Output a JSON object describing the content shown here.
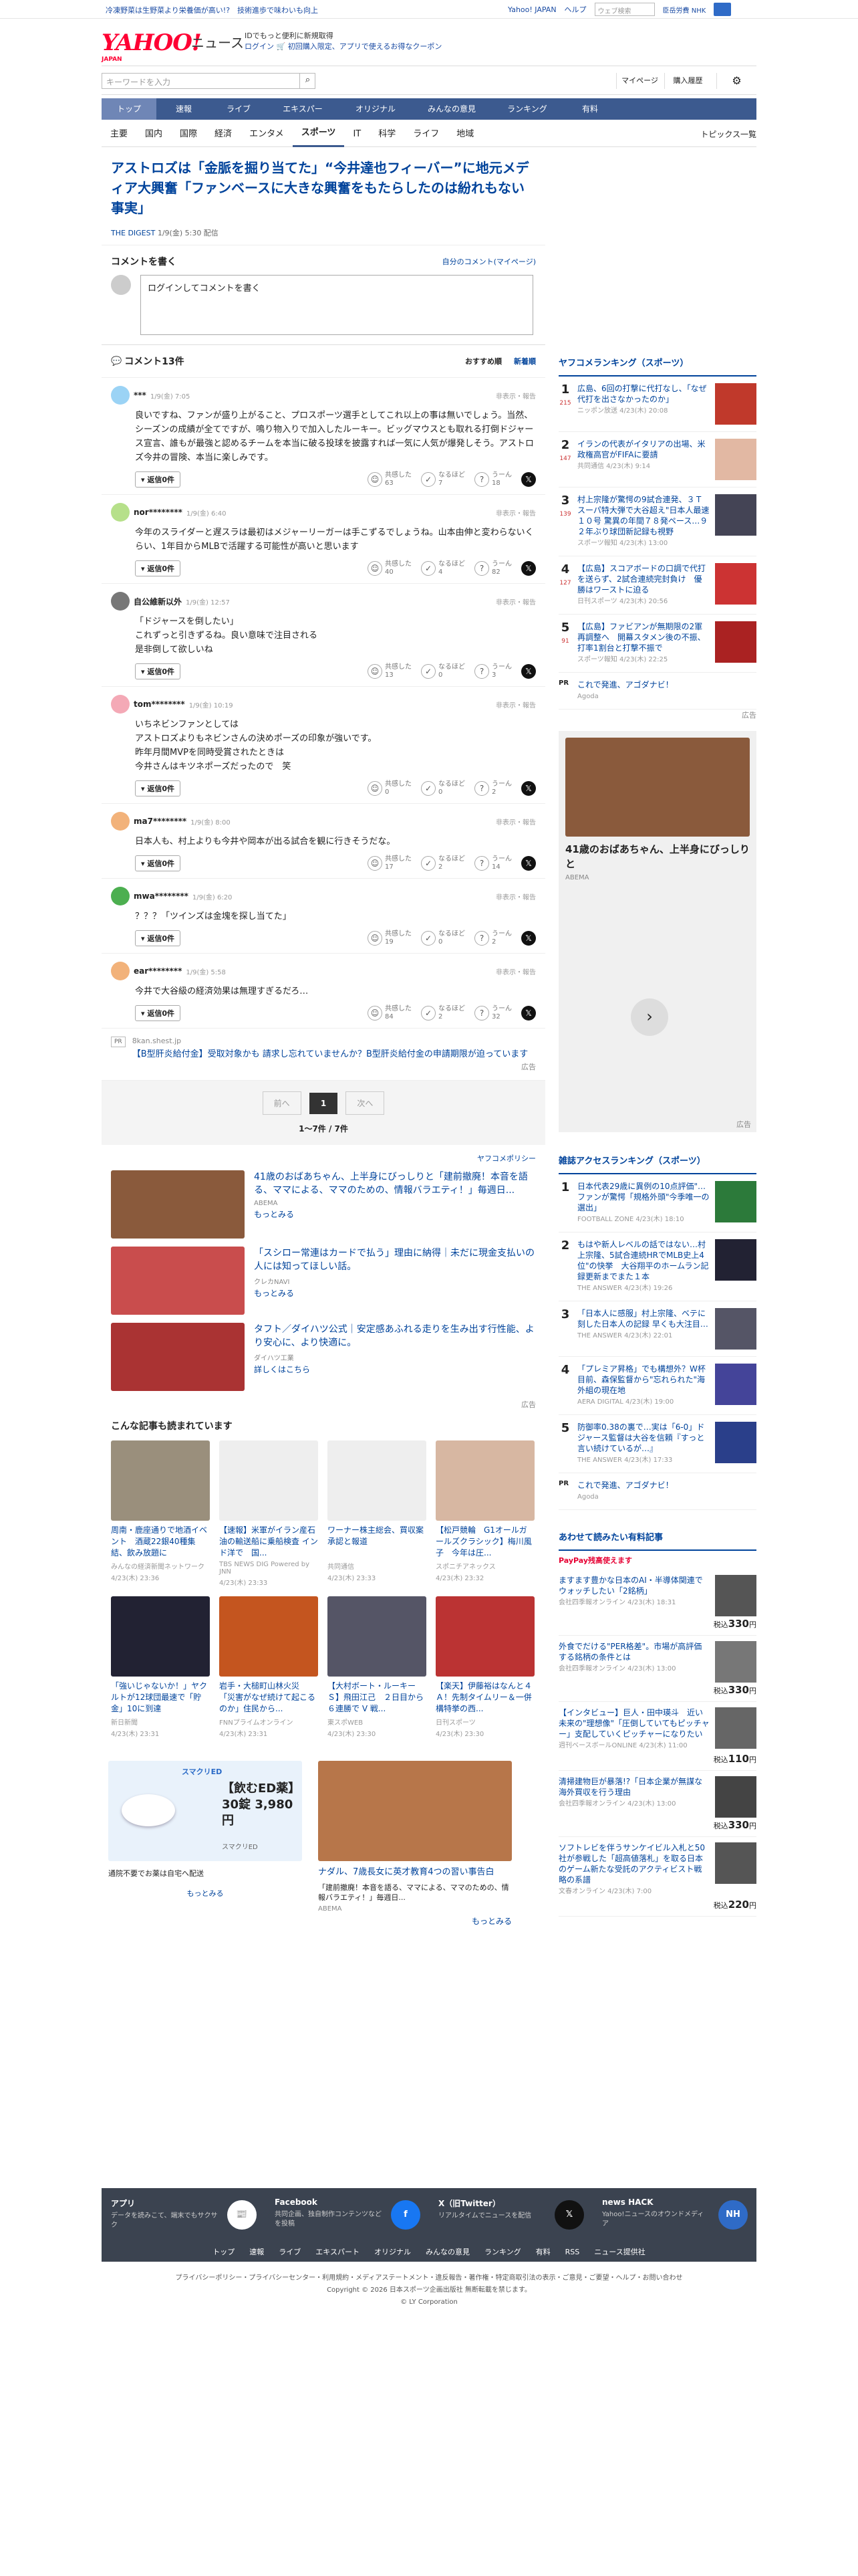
{
  "topbar": {
    "promo": "冷凍野菜は生野菜より栄養価が高い!?　技術進歩で味わいも向上",
    "links": [
      "Yahoo! JAPAN",
      "ヘルプ"
    ],
    "search_placeholder": "ウェブ検索",
    "tag": "臣岳労費 NHK"
  },
  "header": {
    "logo": "YAHOO!",
    "logo_sub": "JAPAN",
    "logo_news": "ニュース",
    "promo_line1": "IDでもっと便利に新規取得",
    "promo_line2": "ログイン 🛒 初回購入限定、アプリで使えるお得なクーポン"
  },
  "search": {
    "placeholder": "キーワードを入力",
    "mypage": "マイページ",
    "subscribe": "購入履歴"
  },
  "gnav": [
    "トップ",
    "速報",
    "ライブ",
    "エキスパート",
    "オリジナル",
    "みんなの意見",
    "ランキング",
    "有料"
  ],
  "subnav": {
    "items": [
      "主要",
      "国内",
      "国際",
      "経済",
      "エンタメ",
      "スポーツ",
      "IT",
      "科学",
      "ライフ",
      "地域"
    ],
    "active": 5,
    "topics": "トピックス一覧"
  },
  "article": {
    "title": "アストロズは「金脈を掘り当てた」“今井達也フィーバー”に地元メディア大興奮「ファンベースに大きな興奮をもたらしたのは紛れもない事実」",
    "source": "THE DIGEST",
    "date": "1/9(金) 5:30 配信"
  },
  "comment_write": {
    "title": "コメントを書く",
    "mine": "自分のコメント(マイページ)",
    "placeholder": "ログインしてコメントを書く"
  },
  "comments_head": {
    "count": "コメント13件",
    "sort1": "おすすめ順",
    "sort2": "新着順"
  },
  "comments": [
    {
      "user": "***",
      "date": "1/9(金) 7:05",
      "report": "非表示・報告",
      "body": "良いですね、ファンが盛り上がること、プロスポーツ選手としてこれ以上の事は無いでしょう。当然、シーズンの成績が全てですが、鳴り物入りで加入したルーキー。ビッグマウスとも取れる打倒ドジャース宣言、誰もが最強と認めるチームを本当に破る投球を披露すれば一気に人気が爆発しそう。アストロズ今井の冒険、本当に楽しみです。",
      "reply": "返信0件",
      "k1": "共感した",
      "v1": "63",
      "k2": "なるほど",
      "v2": "7",
      "k3": "うーん",
      "v3": "18",
      "color": "#9bd3f5"
    },
    {
      "user": "nor********",
      "date": "1/9(金) 6:40",
      "report": "非表示・報告",
      "body": "今年のスライダーと遅スラは最初はメジャーリーガーは手こずるでしょうね。山本由伸と変わらないくらい、1年目からMLBで活躍する可能性が高いと思います",
      "reply": "返信0件",
      "k1": "共感した",
      "v1": "40",
      "k2": "なるほど",
      "v2": "4",
      "k3": "うーん",
      "v3": "82",
      "color": "#b6e08a"
    },
    {
      "user": "自公維新以外",
      "date": "1/9(金) 12:57",
      "report": "非表示・報告",
      "body": "「ドジャースを倒したい」\nこれずっと引きずるね。良い意味で注目される\n是非倒して欲しいね",
      "reply": "返信0件",
      "k1": "共感した",
      "v1": "13",
      "k2": "なるほど",
      "v2": "0",
      "k3": "うーん",
      "v3": "3",
      "color": "#777"
    },
    {
      "user": "tom********",
      "date": "1/9(金) 10:19",
      "report": "非表示・報告",
      "body": "いちネビンファンとしては\nアストロズよりもネビンさんの決めポーズの印象が強いです。\n昨年月間MVPを同時受賞されたときは\n今井さんはキツネポーズだったので　笑",
      "reply": "返信0件",
      "k1": "共感した",
      "v1": "0",
      "k2": "なるほど",
      "v2": "0",
      "k3": "うーん",
      "v3": "2",
      "color": "#f4a9b6"
    },
    {
      "user": "ma7********",
      "date": "1/9(金) 8:00",
      "report": "非表示・報告",
      "body": "日本人も、村上よりも今井や岡本が出る試合を観に行きそうだな。",
      "reply": "返信0件",
      "k1": "共感した",
      "v1": "17",
      "k2": "なるほど",
      "v2": "2",
      "k3": "うーん",
      "v3": "14",
      "color": "#f2b27a"
    },
    {
      "user": "mwa********",
      "date": "1/9(金) 6:20",
      "report": "非表示・報告",
      "body": "？？？「ツインズは金塊を探し当てた」",
      "reply": "返信0件",
      "k1": "共感した",
      "v1": "19",
      "k2": "なるほど",
      "v2": "0",
      "k3": "うーん",
      "v3": "2",
      "color": "#4caf50"
    },
    {
      "user": "ear********",
      "date": "1/9(金) 5:58",
      "report": "非表示・報告",
      "body": "今井で大谷級の経済効果は無理すぎるだろ…",
      "reply": "返信0件",
      "k1": "共感した",
      "v1": "84",
      "k2": "なるほど",
      "v2": "2",
      "k3": "うーん",
      "v3": "32",
      "color": "#f2b27a"
    }
  ],
  "pr": {
    "tag": "PR",
    "source": "8kan.shest.jp",
    "title": "【B型肝炎給付金】受取対象かも 請求し忘れていませんか？B型肝炎給付金の申請期限が迫っています",
    "ad": "広告"
  },
  "pager": {
    "prev": "前へ",
    "cur": "1",
    "next": "次へ",
    "info": "1〜7件 / 7件"
  },
  "ads": {
    "policy": "ヤフコメポリシー",
    "items": [
      {
        "title": "41歳のおばあちゃん、上半身にびっしりと「建前撤廃！本音を語る、ママによる、ママのための、情報バラエティ！」毎週日...",
        "src": "ABEMA",
        "link": "もっとみる",
        "color": "#8a5a3c"
      },
      {
        "title": "「スシロー常連はカードで払う」理由に納得｜未だに現金支払いの人には知ってほしい話。",
        "src": "クレカNAVI",
        "link": "もっとみる",
        "color": "#c94d4d"
      },
      {
        "title": "タフト／ダイハツ公式｜安定感あふれる走りを生み出す行性能、より安心に、より快適に。",
        "src": "ダイハツ工業",
        "link": "詳しくはこちら",
        "color": "#a33"
      }
    ],
    "ad": "広告"
  },
  "recs": {
    "title": "こんな記事も読まれています",
    "items": [
      {
        "title": "周南・鹿座通りで地酒イベント　酒蔵22銀40種集結、飲み放題に",
        "meta": "みんなの経済新聞ネットワーク",
        "color": "#9a8f7c"
      },
      {
        "title": "【速報】米軍がイラン産石油の輸送船に乗船検査 インド洋で　国...",
        "meta": "TBS NEWS DIG Powered by JNN",
        "color": "#eee"
      },
      {
        "title": "ワーナー株主総会、買収案承認と報道",
        "meta": "共同通信",
        "color": "#eee"
      },
      {
        "title": "【松戸競輪　G1オールガールズクラシック】梅川風子　今年は圧...",
        "meta": "スポニチアネックス",
        "color": "#d7b7a2"
      },
      {
        "title": "「強いじゃないか！」ヤクルトが12球団最速で「貯金」10に到達",
        "meta": "新日新聞",
        "color": "#223"
      },
      {
        "title": "岩手・大槌町山林火災　「災害がなぜ続けて起こるのか」住民から...",
        "meta": "FNNプライムオンライン",
        "color": "#c4551f"
      },
      {
        "title": "【大村ボート・ルーキーＳ】飛田江己　２日目から６連勝で V 戦...",
        "meta": "東スポWEB",
        "color": "#556"
      },
      {
        "title": "【楽天】伊藤裕はなんと４Ａ！先制タイムリー＆一併構特挙の西...",
        "meta": "日刊スポーツ",
        "color": "#b33"
      }
    ],
    "dates": [
      "4/23(木) 23:36",
      "4/23(木) 23:33",
      "4/23(木) 23:33",
      "4/23(木) 23:32",
      "4/23(木) 23:31",
      "4/23(木) 23:31",
      "4/23(木) 23:30",
      "4/23(木) 23:30"
    ]
  },
  "bottom_ads": [
    {
      "brand": "スマクリED",
      "title": "【飲むED薬】30錠 3,980円",
      "src": "スマクリED",
      "desc": "通院不要でお薬は自宅へ配送",
      "link": "もっとみる"
    },
    {
      "title": "ナダル、7歳長女に英才教育4つの習い事告白",
      "desc": "「建前撤廃！本音を語る、ママによる、ママのための、情報バラエティ！」毎週日...",
      "src": "ABEMA",
      "link": "もっとみる"
    }
  ],
  "ranking": {
    "title": "ヤフコメランキング（スポーツ）",
    "items": [
      {
        "num": "1",
        "count": "215",
        "title": "広島、6回の打撃に代打なし、「なぜ代打を出さなかったのか」",
        "meta": "ニッポン放送 4/23(木) 20:08",
        "color": "#c0392b"
      },
      {
        "num": "2",
        "count": "147",
        "title": "イランの代表がイタリアの出場、米政権高官がFIFAに要請",
        "meta": "共同通信 4/23(木) 9:14",
        "color": "#e2b8a3"
      },
      {
        "num": "3",
        "count": "139",
        "title": "村上宗隆が驚愕の9試合連発、３Ｔスーパ特大弾で大谷超え\"日本人最速１０号 驚異の年間７８発ペース…９２年ぶり球団新記録も視野",
        "meta": "スポーツ報知 4/23(木) 13:00",
        "color": "#445"
      },
      {
        "num": "4",
        "count": "127",
        "title": "【広島】スコアボードの口調で代打を送らず、2試合連続完封負け　優勝はワーストに迫る",
        "meta": "日刊スポーツ 4/23(木) 20:56",
        "color": "#c33"
      },
      {
        "num": "5",
        "count": "91",
        "title": "【広島】ファビアンが無期限の2軍再調整へ　開幕スタメン後の不振、打率1割台と打撃不振で",
        "meta": "スポーツ報知 4/23(木) 22:25",
        "color": "#a22"
      }
    ],
    "pr_title": "これで発進、アゴダナビ！",
    "pr_src": "Agoda",
    "ad": "広告"
  },
  "right_ad": {
    "title": "41歳のおばあちゃん、上半身にびっしりと",
    "src": "ABEMA",
    "ad": "広告"
  },
  "access": {
    "title": "雑誌アクセスランキング（スポーツ）",
    "items": [
      {
        "num": "1",
        "title": "日本代表29歳に異例の10点評価\"…ファンが驚愕「規格外頭\"今季唯一の選出」",
        "meta": "FOOTBALL ZONE 4/23(木) 18:10",
        "color": "#2c7a3a"
      },
      {
        "num": "2",
        "title": "もはや新人レベルの話ではない…村上宗隆、5試合連続HRでMLB史上4位\"の快挙　大谷翔平のホームラン記録更新までまた１本",
        "meta": "THE ANSWER 4/23(木) 19:26",
        "color": "#223"
      },
      {
        "num": "3",
        "title": "「日本人に感服」村上宗隆、ベテに刻した日本人の記録 早くも大注目…",
        "meta": "THE ANSWER 4/23(木) 22:01",
        "color": "#556"
      },
      {
        "num": "4",
        "title": "「プレミア昇格」でも構想外？W杯目前、森保監督から\"忘れられた\"海外組の現在地",
        "meta": "AERA DIGITAL 4/23(木) 19:00",
        "color": "#449"
      },
      {
        "num": "5",
        "title": "防御率0.38の裏で…実は「6-0」ドジャース監督は大谷を信頼『すっと言い続けているが…』",
        "meta": "THE ANSWER 4/23(木) 17:33",
        "color": "#2a3f8a"
      }
    ],
    "pr_title": "これで発進、アゴダナビ！",
    "pr_src": "Agoda"
  },
  "paid": {
    "title": "あわせて読みたい有料記事",
    "badge": "PayPay残高使えます",
    "items": [
      {
        "title": "ますます豊かな日本のAI・半導体関連でウォッチしたい「2銘柄」",
        "meta": "会社四季報オンライン 4/23(木) 18:31",
        "price": "330",
        "color": "#555"
      },
      {
        "title": "外食でだける\"PER格差\"。市場が高評価する銘柄の条件とは",
        "meta": "会社四季報オンライン 4/23(木) 13:00",
        "price": "330",
        "color": "#777"
      },
      {
        "title": "【インタビュー】巨人・田中瑛斗　近い未来の\"理想像\"「圧倒していてもピッチャー」支配していくピッチャーになりたい",
        "meta": "週刊ベースボールONLINE 4/23(木) 11:00",
        "price": "110",
        "color": "#666"
      },
      {
        "title": "清掃建物巨が暴落!?「日本企業が無謀な海外買収を行う理由",
        "meta": "会社四季報オンライン 4/23(木) 13:00",
        "price": "330",
        "color": "#444"
      },
      {
        "title": "ソフトレビを伴うサンケイビル入札と50社が参戦した「超高値落札」を取る日本のゲーム新たな受託のアクティビスト戦略の系譜",
        "meta": "文春オンライン 4/23(木) 7:00",
        "price": "220",
        "color": "#555"
      }
    ],
    "price_prefix": "税込",
    "price_unit": "円"
  },
  "footer": {
    "items": [
      {
        "name": "アプリ",
        "desc": "データを読みこて、端末でもサクサク",
        "color": "#fff"
      },
      {
        "name": "Facebook",
        "desc": "共同企画、独自制作コンテンツなどを投稿",
        "color": "#1877f2"
      },
      {
        "name": "X（旧Twitter）",
        "desc": "リアルタイムでニュースを配信",
        "color": "#111"
      },
      {
        "name": "news HACK",
        "desc": "Yahoo!ニュースのオウンドメディア",
        "color": "#2f6bc7"
      }
    ],
    "nav": [
      "トップ",
      "速報",
      "ライブ",
      "エキスパート",
      "オリジナル",
      "みんなの意見",
      "ランキング",
      "有料",
      "RSS",
      "ニュース提供社"
    ],
    "legal1": "プライバシーポリシー・プライバシーセンター・利用規約・メディアステートメント・違反報告・著作権・特定商取引法の表示・ご意見・ご要望・ヘルプ・お問い合わせ",
    "legal2": "Copyright © 2026 日本スポーツ企画出版社 無断転載を禁じます。",
    "legal3": "© LY Corporation"
  }
}
